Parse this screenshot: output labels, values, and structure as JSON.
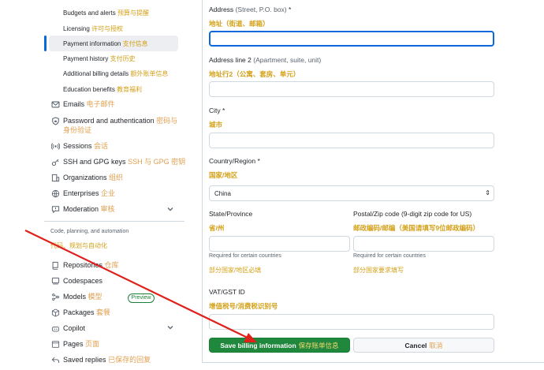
{
  "sidebar": {
    "sub_items": [
      {
        "en": "Budgets and alerts",
        "zh": "预算与提醒"
      },
      {
        "en": "Licensing",
        "zh": "许可与授权"
      },
      {
        "en": "Payment information",
        "zh": "支付信息"
      },
      {
        "en": "Payment history",
        "zh": "支付历史"
      },
      {
        "en": "Additional billing details",
        "zh": "额外账单信息"
      },
      {
        "en": "Education benefits",
        "zh": "教育福利"
      }
    ],
    "items": [
      {
        "en": "Emails",
        "zh": "电子邮件"
      },
      {
        "en": "Password and authentication",
        "zh": "密码与",
        "zh2": "身份验证"
      },
      {
        "en": "Sessions",
        "zh": "会话"
      },
      {
        "en": "SSH and GPG keys",
        "zh": "SSH 与 GPG 密钥"
      },
      {
        "en": "Organizations",
        "zh": "组织"
      },
      {
        "en": "Enterprises",
        "zh": "企业"
      },
      {
        "en": "Moderation",
        "zh": "审核"
      }
    ],
    "section_heading": "Code, planning, and automation",
    "section_heading_zh": "代码、规划与自动化",
    "code_items": [
      {
        "en": "Repositories",
        "zh": "仓库"
      },
      {
        "en": "Codespaces",
        "zh": ""
      },
      {
        "en": "Models",
        "zh": "模型",
        "badge": "Preview"
      },
      {
        "en": "Packages",
        "zh": "套餐"
      },
      {
        "en": "Copilot",
        "zh": ""
      },
      {
        "en": "Pages",
        "zh": "页面"
      },
      {
        "en": "Saved replies",
        "zh": "已保存的回复"
      }
    ]
  },
  "form": {
    "address": {
      "label": "Address",
      "hint": "(Street, P.O. box)",
      "required": "*",
      "zh": "地址（街道、邮箱）"
    },
    "address2": {
      "label": "Address line 2",
      "hint": "(Apartment, suite, unit)",
      "zh": "地址行2（公寓、套房、单元）"
    },
    "city": {
      "label": "City",
      "required": "*",
      "zh": "城市"
    },
    "country": {
      "label": "Country/Region",
      "required": "*",
      "zh": "国家/地区",
      "value": "China"
    },
    "state": {
      "label": "State/Province",
      "zh": "省/州",
      "help": "Required for certain countries",
      "help_zh": "部分国家/地区必填"
    },
    "postal": {
      "label": "Postal/Zip code",
      "hint": "(9-digit zip code for US)",
      "zh": "邮政编码/邮编（美国请填写9位邮政编码）",
      "help": "Required for certain countries",
      "help_zh": "部分国家要求填写"
    },
    "vat": {
      "label": "VAT/GST ID",
      "zh": "增值税号/消费税识别号"
    },
    "save": {
      "en": "Save billing information",
      "zh": "保存账单信息"
    },
    "cancel": {
      "en": "Cancel",
      "zh": "取消"
    }
  },
  "colors": {
    "accent": "#0969da",
    "save_green": "#1f883d",
    "annotation_red": "#e0201b",
    "zh_gold": "#d4a017"
  }
}
